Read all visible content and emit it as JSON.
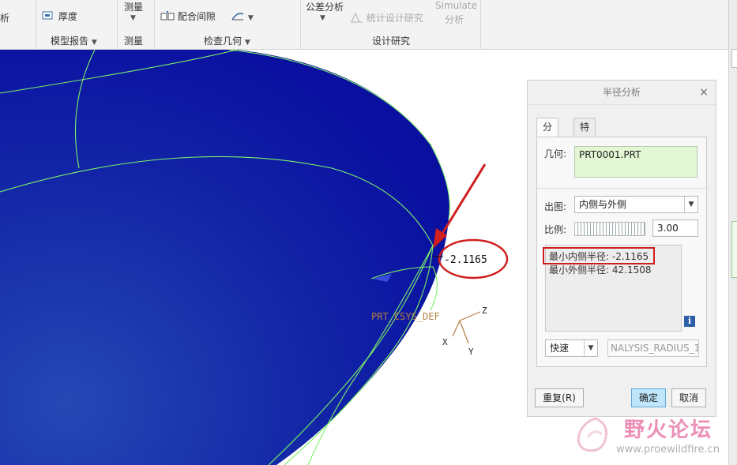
{
  "ribbon": {
    "cut_left": "析",
    "thickness": "厚度",
    "measure_top": "测量",
    "mate_gap": "配合间隙",
    "tolerance": "公差分析",
    "stat_design": "统计设计研究",
    "simulate_1": "Simulate",
    "simulate_2": "分析",
    "group_model_report": "模型报告",
    "group_measure": "测量",
    "group_inspect": "检查几何",
    "group_design_study": "设计研究"
  },
  "viewport": {
    "callout_value": "-2.1165",
    "csys_label": "PRT_CSYS_DEF",
    "axis_x": "X",
    "axis_y": "Y",
    "axis_z": "Z"
  },
  "dialog": {
    "title": "半径分析",
    "close": "×",
    "tabs": [
      "分析",
      "特征"
    ],
    "geometry_label": "几何:",
    "geometry_value": "PRT0001.PRT",
    "plot_label": "出图:",
    "plot_value": "内侧与外侧",
    "scale_label": "比例:",
    "scale_value": "3.00",
    "result_min_inner": "最小内侧半径: -2.1165",
    "result_min_outer": "最小外侧半径: 42.1508",
    "info_icon": "i",
    "mode_value": "快速",
    "name_value": "NALYSIS_RADIUS_1",
    "repeat_button": "重复(R)",
    "ok_button": "确定",
    "cancel_button": "取消"
  },
  "watermark": {
    "brand": "野火论坛",
    "url": "www.proewildfire.cn"
  },
  "colors": {
    "part_blue": "#0a0fa0",
    "edge_green": "#7cf06a",
    "annotation_red": "#d01e1e"
  }
}
